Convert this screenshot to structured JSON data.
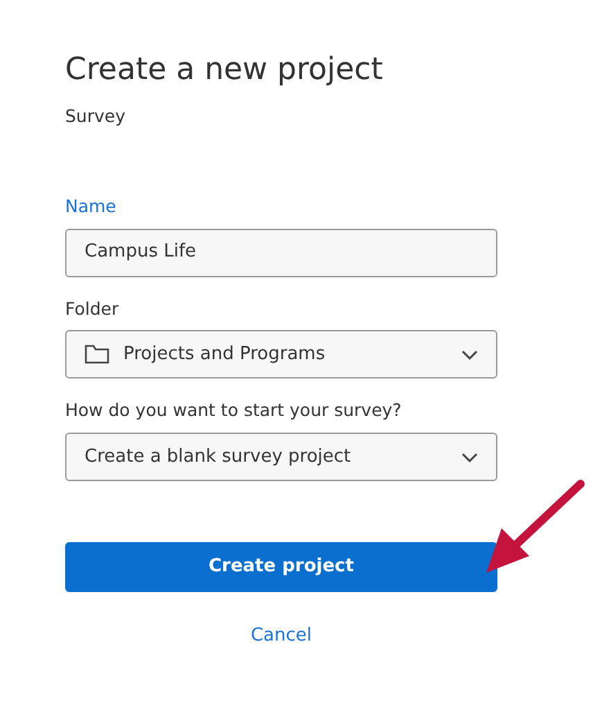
{
  "title": "Create a new project",
  "subtitle": "Survey",
  "fields": [
    {
      "kind": "text",
      "label": "Name",
      "value": "Campus Life",
      "focused": true
    },
    {
      "kind": "folder-select",
      "label": "Folder",
      "value": "Projects and Programs",
      "focused": false
    },
    {
      "kind": "select",
      "label": "How do you want to start your survey?",
      "value": "Create a blank survey project",
      "focused": false
    }
  ],
  "primary_button": "Create project",
  "cancel_link": "Cancel"
}
